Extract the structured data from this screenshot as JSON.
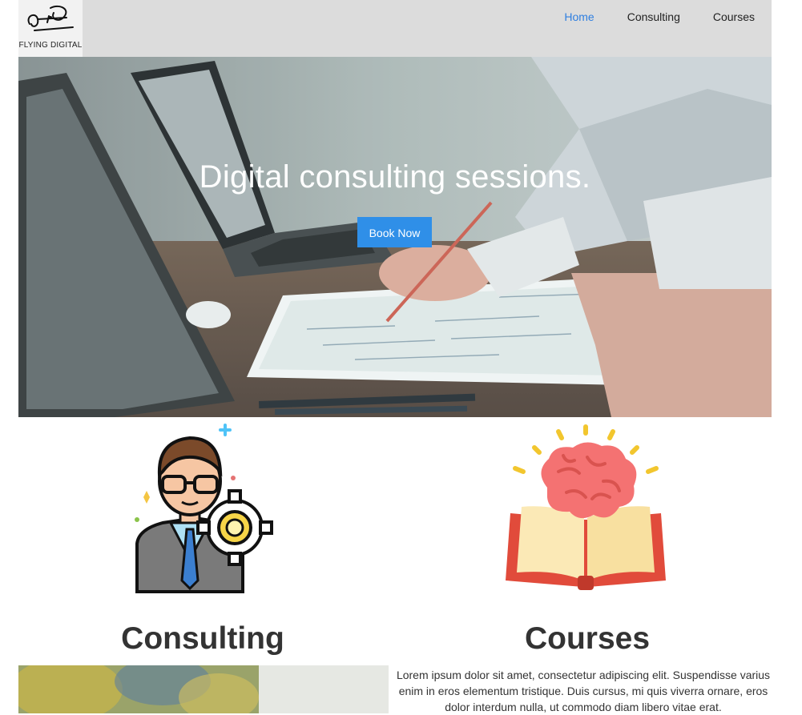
{
  "header": {
    "logo_text": "FLYING DIGITAL",
    "nav": [
      {
        "label": "Home",
        "active": true
      },
      {
        "label": "Consulting",
        "active": false
      },
      {
        "label": "Courses",
        "active": false
      }
    ],
    "active_color": "#2f7fe0"
  },
  "hero": {
    "title": "Digital consulting sessions.",
    "button_label": "Book Now",
    "button_color": "#2f8fe8"
  },
  "features": {
    "consulting": {
      "title": "Consulting",
      "icon": "consultant-gear-icon"
    },
    "courses": {
      "title": "Courses",
      "icon": "brain-book-icon",
      "text": "Lorem ipsum dolor sit amet, consectetur adipiscing elit. Suspendisse varius enim in eros elementum tristique. Duis cursus, mi quis viverra ornare, eros dolor interdum nulla, ut commodo diam libero vitae erat."
    }
  }
}
